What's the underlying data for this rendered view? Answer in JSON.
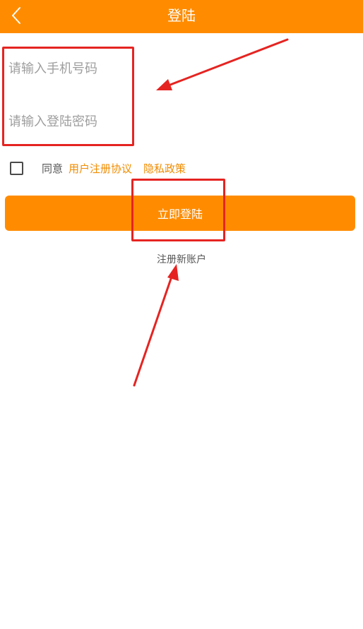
{
  "header": {
    "title": "登陆",
    "back_icon": "chevron-left-icon",
    "background_color": "#ff8c00"
  },
  "form": {
    "phone_placeholder": "请输入手机号码",
    "password_placeholder": "请输入登陆密码",
    "agree_label": "同意",
    "terms_link": "用户注册协议",
    "privacy_link": "隐私政策",
    "checkbox_checked": false
  },
  "actions": {
    "login_button": "立即登陆",
    "register_link": "注册新账户"
  },
  "colors": {
    "accent": "#ff8c00",
    "link": "#f08c00",
    "annotation": "#e52421"
  }
}
